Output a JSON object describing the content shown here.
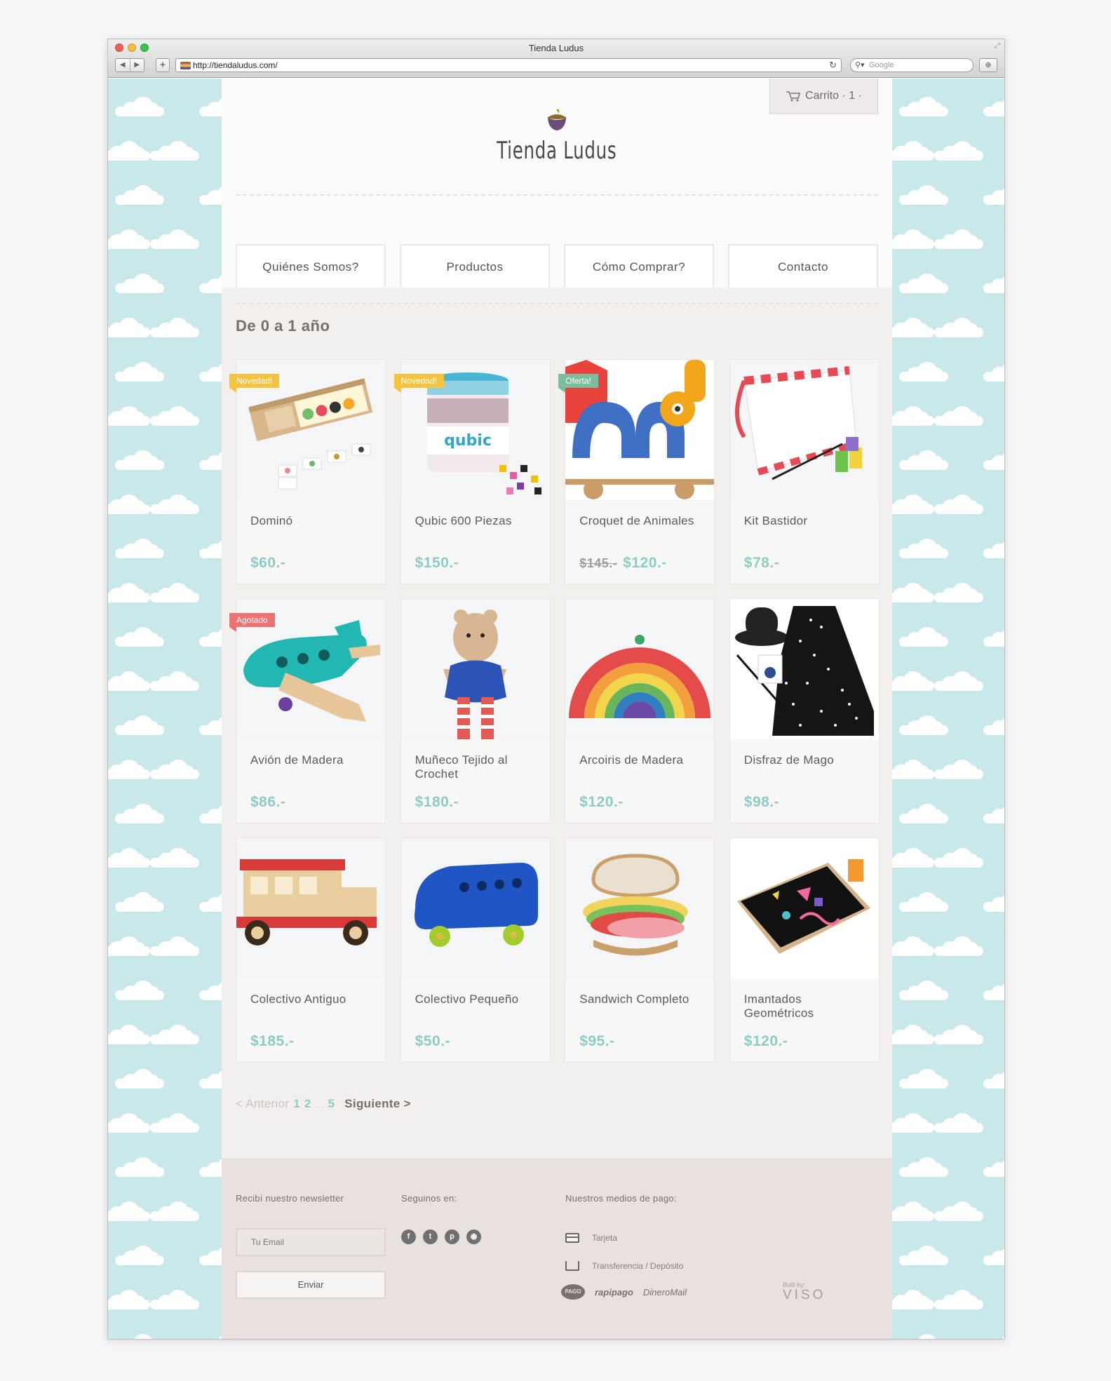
{
  "window": {
    "title": "Tienda Ludus",
    "url": "http://tiendaludus.com/",
    "search_placeholder": "Google"
  },
  "header": {
    "cart_label": "Carrito · 1 ·",
    "logo_text": "Tienda Ludus"
  },
  "nav": [
    {
      "label": "Quiénes Somos?"
    },
    {
      "label": "Productos"
    },
    {
      "label": "Cómo Comprar?"
    },
    {
      "label": "Contacto"
    }
  ],
  "category_title": "De 0 a 1 año",
  "products": [
    {
      "name": "Dominó",
      "price": "$60.-",
      "old_price": "",
      "badge": "Novedad!",
      "badge_color": "#f4c440"
    },
    {
      "name": "Qubic 600 Piezas",
      "price": "$150.-",
      "old_price": "",
      "badge": "Novedad!",
      "badge_color": "#f4c440"
    },
    {
      "name": "Croquet de Animales",
      "price": "$120.-",
      "old_price": "$145.-",
      "badge": "Oferta!",
      "badge_color": "#7cbd9d"
    },
    {
      "name": "Kit Bastidor",
      "price": "$78.-",
      "old_price": "",
      "badge": "",
      "badge_color": ""
    },
    {
      "name": "Avión de Madera",
      "price": "$86.-",
      "old_price": "",
      "badge": "Agotado",
      "badge_color": "#ec7170"
    },
    {
      "name": "Muñeco Tejido al Crochet",
      "price": "$180.-",
      "old_price": "",
      "badge": "",
      "badge_color": ""
    },
    {
      "name": "Arcoiris de Madera",
      "price": "$120.-",
      "old_price": "",
      "badge": "",
      "badge_color": ""
    },
    {
      "name": "Disfraz de Mago",
      "price": "$98.-",
      "old_price": "",
      "badge": "",
      "badge_color": ""
    },
    {
      "name": "Colectivo Antiguo",
      "price": "$185.-",
      "old_price": "",
      "badge": "",
      "badge_color": ""
    },
    {
      "name": "Colectivo Pequeño",
      "price": "$50.-",
      "old_price": "",
      "badge": "",
      "badge_color": ""
    },
    {
      "name": "Sandwich Completo",
      "price": "$95.-",
      "old_price": "",
      "badge": "",
      "badge_color": ""
    },
    {
      "name": "Imantados Geométricos",
      "price": "$120.-",
      "old_price": "",
      "badge": "",
      "badge_color": ""
    }
  ],
  "pagination": {
    "prev": "< Anterior",
    "pages": [
      "1",
      "2"
    ],
    "ellipsis": "...",
    "last": "5",
    "next": "Siguiente >"
  },
  "footer": {
    "newsletter_title": "Recibí nuestro newsletter",
    "email_placeholder": "Tu Email",
    "send_label": "Enviar",
    "social_title": "Seguinos en:",
    "payment_title": "Nuestros medios de pago:",
    "payment_card": "Tarjeta",
    "payment_transfer": "Transferencia / Depósito",
    "brand_pago": "PAGO",
    "brand_rapipago": "rapipago",
    "brand_dineromail": "DineroMail",
    "built_by_label": "Built by:",
    "built_by_name": "VISO"
  },
  "colors": {
    "sky": "#c9e8ea",
    "price": "#8fcbc5",
    "footer_bg": "#e8e1de"
  }
}
